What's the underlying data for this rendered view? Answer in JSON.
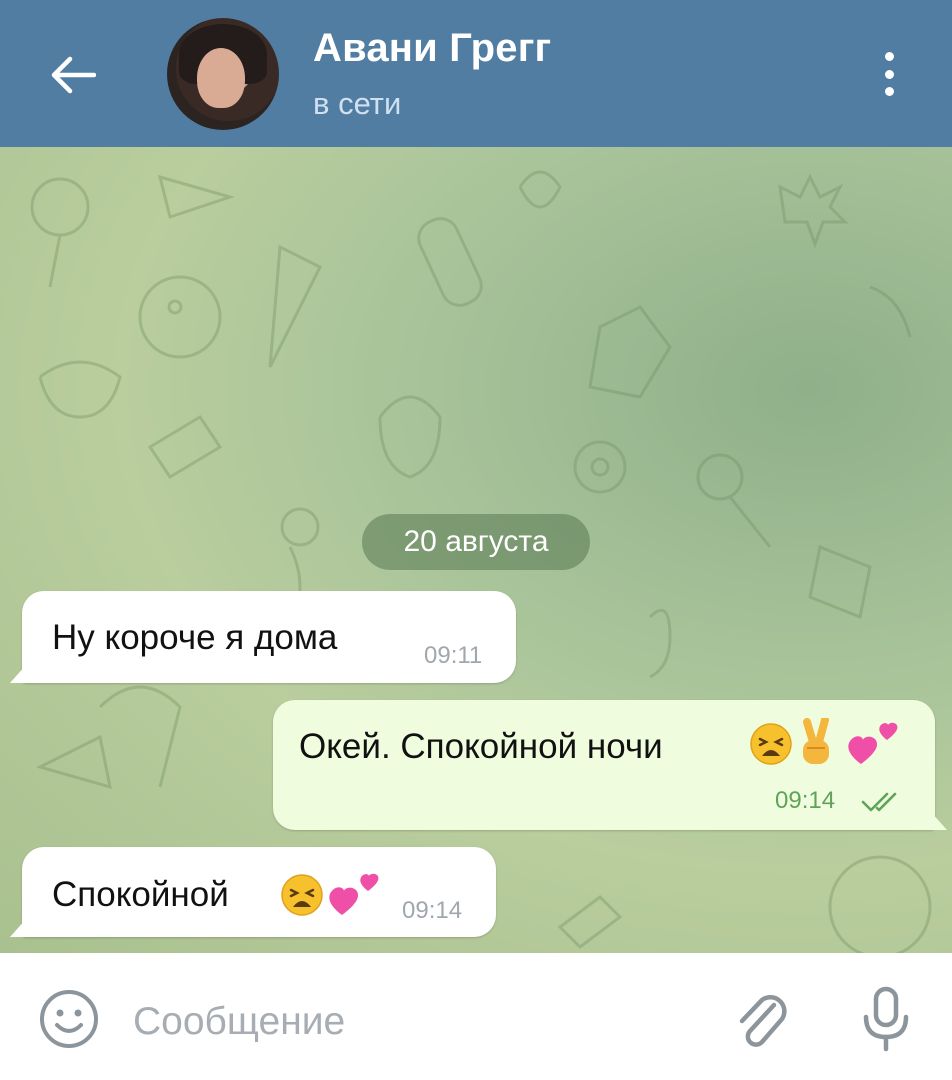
{
  "header": {
    "contact_name": "Авани Грегг",
    "status": "в сети",
    "back_icon": "arrow-left-icon",
    "menu_icon": "more-vertical-icon",
    "background_color": "#517da2"
  },
  "chat": {
    "date_separator": "20 августа",
    "messages": [
      {
        "direction": "incoming",
        "text": "Ну короче я дома",
        "time": "09:11"
      },
      {
        "direction": "outgoing",
        "text": "Окей. Спокойной ночи",
        "emojis": [
          "weary-face",
          "victory-hand",
          "two-hearts"
        ],
        "time": "09:14",
        "status": "read"
      },
      {
        "direction": "incoming",
        "text": "Спокойной",
        "emojis": [
          "weary-face",
          "two-hearts"
        ],
        "time": "09:14"
      }
    ],
    "outgoing_bubble_color": "#effdde",
    "incoming_bubble_color": "#ffffff"
  },
  "composer": {
    "placeholder": "Сообщение",
    "emoji_icon": "smiley-icon",
    "attach_icon": "paperclip-icon",
    "mic_icon": "microphone-icon"
  }
}
